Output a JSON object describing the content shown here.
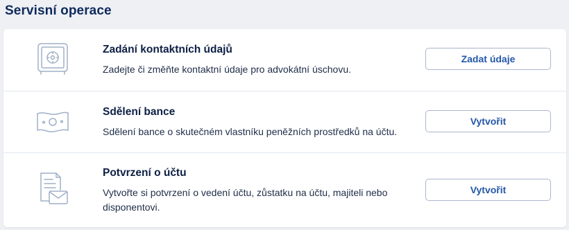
{
  "section": {
    "title": "Servisní operace"
  },
  "operations": [
    {
      "icon": "safe-icon",
      "title": "Zadání kontaktních údajů",
      "description": "Zadejte či změňte kontaktní údaje pro advokátní úschovu.",
      "button_label": "Zadat údaje"
    },
    {
      "icon": "banknote-icon",
      "title": "Sdělení bance",
      "description": "Sdělení bance o skutečném vlastníku peněžních prostředků na účtu.",
      "button_label": "Vytvořit"
    },
    {
      "icon": "document-envelope-icon",
      "title": "Potvrzení o účtu",
      "description": "Vytvořte si potvrzení o vedení účtu, zůstatku na účtu, majiteli nebo disponentovi.",
      "button_label": "Vytvořit"
    }
  ],
  "colors": {
    "page_background": "#eef0f4",
    "card_background": "#ffffff",
    "title_text": "#0c1f44",
    "button_text": "#2456a8",
    "button_border": "#aab7cc",
    "icon_stroke": "#9fb0c7"
  }
}
